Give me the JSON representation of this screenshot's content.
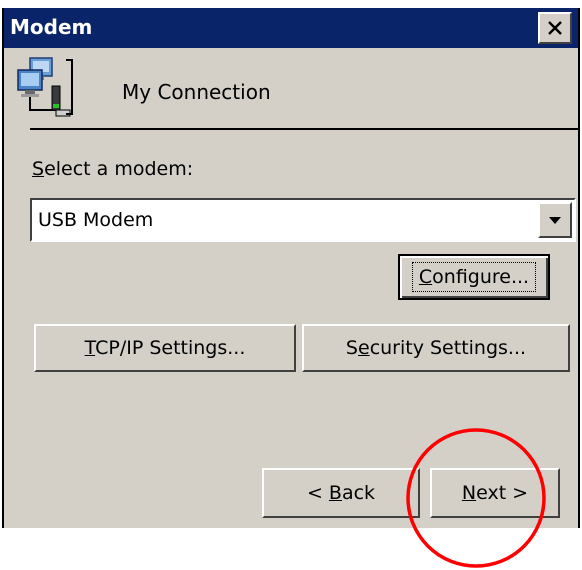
{
  "window": {
    "title": "Modem",
    "close_glyph": "×"
  },
  "connection": {
    "name": "My Connection",
    "icon": "network-connection-icon"
  },
  "modem": {
    "label_prefix": "",
    "label_underlined": "S",
    "label_rest": "elect a modem:",
    "selected_value": "USB Modem",
    "dropdown_icon": "chevron-down-icon"
  },
  "buttons": {
    "configure": {
      "underlined": "C",
      "rest": "onfigure..."
    },
    "tcp": {
      "underlined": "T",
      "rest": "CP/IP Settings..."
    },
    "security": {
      "prefix": "S",
      "underlined": "e",
      "rest": "curity Settings..."
    },
    "back": {
      "prefix": "< ",
      "underlined": "B",
      "rest": "ack"
    },
    "next": {
      "underlined": "N",
      "rest": "ext >"
    }
  },
  "annotation": {
    "color": "#ff0000"
  }
}
